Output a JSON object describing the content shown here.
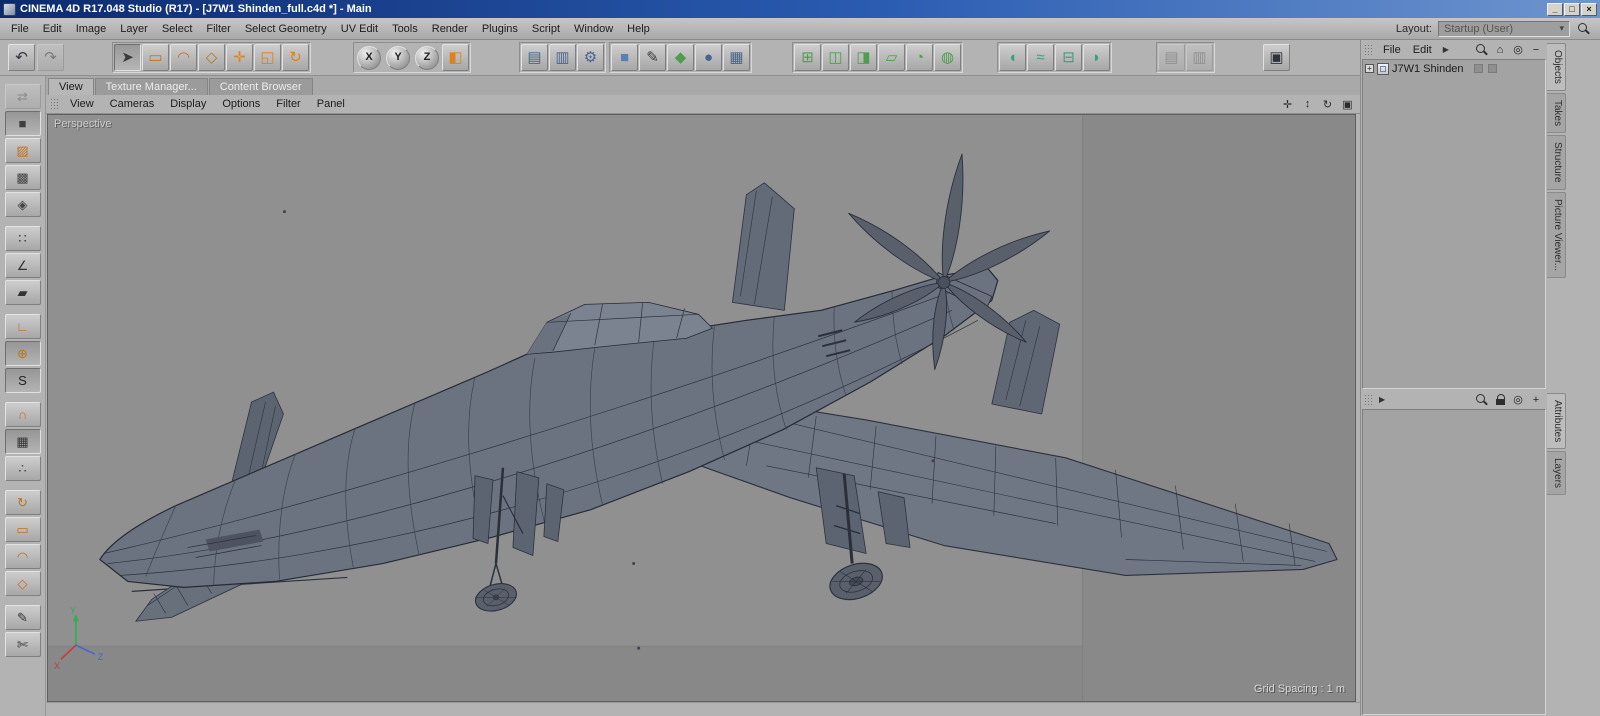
{
  "window": {
    "title": "CINEMA 4D R17.048 Studio (R17) - [J7W1 Shinden_full.c4d *] - Main",
    "controls": [
      {
        "n": "minimize-button",
        "g": "_"
      },
      {
        "n": "maximize-button",
        "g": "□"
      },
      {
        "n": "close-button",
        "g": "×"
      }
    ]
  },
  "menubar": {
    "items": [
      "File",
      "Edit",
      "Image",
      "Layer",
      "Select",
      "Filter",
      "Select Geometry",
      "UV Edit",
      "Tools",
      "Render",
      "Plugins",
      "Script",
      "Window",
      "Help"
    ],
    "layout_label": "Layout:",
    "layout_value": "Startup (User)",
    "layout_caret": "▾"
  },
  "toolbar": {
    "history": [
      {
        "n": "undo-button",
        "g": "↶",
        "c": "#2f343c"
      },
      {
        "n": "redo-button",
        "g": "↷",
        "c": "#2f343c",
        "cls": "disabled"
      }
    ],
    "selection": [
      {
        "n": "live-selection-tool",
        "g": "➤",
        "c": "#3a3a3a",
        "cls": "active"
      },
      {
        "n": "rectangle-selection-tool",
        "g": "▭",
        "c": "#c0731d"
      },
      {
        "n": "lasso-selection-tool",
        "g": "◠",
        "c": "#c0731d"
      },
      {
        "n": "polygon-selection-tool",
        "g": "◇",
        "c": "#c0731d"
      },
      {
        "n": "move-tool",
        "g": "✛",
        "c": "#d9851c"
      },
      {
        "n": "scale-tool",
        "g": "◱",
        "c": "#d9851c"
      },
      {
        "n": "rotate-tool",
        "g": "↻",
        "c": "#d9851c"
      }
    ],
    "axis": [
      {
        "n": "x-axis-lock-button",
        "g": "X",
        "c": "#222222",
        "cls": "ball"
      },
      {
        "n": "y-axis-lock-button",
        "g": "Y",
        "c": "#222222",
        "cls": "ball"
      },
      {
        "n": "z-axis-lock-button",
        "g": "Z",
        "c": "#222222",
        "cls": "ball"
      },
      {
        "n": "coordinate-system-button",
        "g": "◧",
        "c": "#d9851c"
      }
    ],
    "render": [
      {
        "n": "render-view-button",
        "g": "▤",
        "c": "#49648f"
      },
      {
        "n": "render-picture-viewer-button",
        "g": "▥",
        "c": "#49648f"
      },
      {
        "n": "render-settings-button",
        "g": "⚙",
        "c": "#49648f"
      }
    ],
    "create": [
      {
        "n": "add-cube-button",
        "g": "■",
        "c": "#5b7fb5"
      },
      {
        "n": "spline-pen-button",
        "g": "✎",
        "c": "#3c3c3c"
      },
      {
        "n": "subdivision-surface-button",
        "g": "◆",
        "c": "#4e9e4e"
      },
      {
        "n": "volume-builder-button",
        "g": "●",
        "c": "#49648f"
      },
      {
        "n": "floor-button",
        "g": "▦",
        "c": "#49648f"
      }
    ],
    "modeling": [
      {
        "n": "array-button",
        "g": "⊞",
        "c": "#4e9e4e"
      },
      {
        "n": "boole-button",
        "g": "◫",
        "c": "#4e9e4e"
      },
      {
        "n": "symmetry-button",
        "g": "◨",
        "c": "#4e9e4e"
      },
      {
        "n": "instance-button",
        "g": "▱",
        "c": "#4e9e4e"
      },
      {
        "n": "spline-mask-button",
        "g": "◔",
        "c": "#4e9e4e"
      },
      {
        "n": "connect-button",
        "g": "◍",
        "c": "#4e9e4e"
      }
    ],
    "deformers": [
      {
        "n": "bend-deformer-button",
        "g": "◖",
        "c": "#3f9e7a"
      },
      {
        "n": "twist-deformer-button",
        "g": "≈",
        "c": "#3f9e7a"
      },
      {
        "n": "ffd-deformer-button",
        "g": "⊟",
        "c": "#3f9e7a"
      },
      {
        "n": "taper-deformer-button",
        "g": "◗",
        "c": "#3f9e7a"
      }
    ],
    "extras": [
      {
        "n": "workplane-toggle-button",
        "g": "▤",
        "c": "#666666",
        "cls": "disabled"
      },
      {
        "n": "snap-settings-button",
        "g": "▥",
        "c": "#666666",
        "cls": "disabled"
      }
    ],
    "panel": [
      {
        "n": "viewport-panel-button",
        "g": "▣",
        "c": "#2f343c"
      }
    ]
  },
  "left_toolbar": {
    "items": [
      {
        "n": "make-editable-button",
        "g": "⇄",
        "c": "#555555",
        "cls": "disabled"
      },
      {
        "n": "model-mode-button",
        "g": "■",
        "c": "#3e3e3e",
        "cls": "active"
      },
      {
        "n": "texture-mode-button",
        "g": "▨",
        "c": "#c0731d"
      },
      {
        "n": "texture-button",
        "g": "▩",
        "c": "#444444"
      },
      {
        "n": "workplane-button",
        "g": "◈",
        "c": "#444444"
      },
      {
        "n": "separator",
        "cls": "spacer"
      },
      {
        "n": "points-mode-button",
        "g": "∷",
        "c": "#333333"
      },
      {
        "n": "edges-mode-button",
        "g": "∠",
        "c": "#333333"
      },
      {
        "n": "polygons-mode-button",
        "g": "▰",
        "c": "#333333"
      },
      {
        "n": "separator",
        "cls": "spacer"
      },
      {
        "n": "object-axis-button",
        "g": "∟",
        "c": "#c0731d"
      },
      {
        "n": "enable-axis-button",
        "g": "⊕",
        "c": "#c0731d",
        "cls": "active"
      },
      {
        "n": "snap-button",
        "g": "S",
        "c": "#222222",
        "cls": "active"
      },
      {
        "n": "separator",
        "cls": "spacer"
      },
      {
        "n": "magnet-button",
        "g": "∩",
        "c": "#c0731d"
      },
      {
        "n": "grid-snap-button",
        "g": "▦",
        "c": "#333333",
        "cls": "active"
      },
      {
        "n": "quantize-button",
        "g": "∴",
        "c": "#444444"
      },
      {
        "n": "separator",
        "cls": "spacer"
      },
      {
        "n": "rotate-ring-button",
        "g": "↻",
        "c": "#c0731d"
      },
      {
        "n": "rect-select-button",
        "g": "▭",
        "c": "#c0731d"
      },
      {
        "n": "lasso-select-button",
        "g": "◠",
        "c": "#c0731d"
      },
      {
        "n": "poly-select-button",
        "g": "◇",
        "c": "#c0731d"
      },
      {
        "n": "separator",
        "cls": "spacer"
      },
      {
        "n": "brush-button",
        "g": "✎",
        "c": "#333333"
      },
      {
        "n": "knife-button",
        "g": "✄",
        "c": "#333333"
      }
    ]
  },
  "center": {
    "doc_tabs": [
      {
        "n": "tab-view",
        "label": "View",
        "cls": "active"
      },
      {
        "n": "tab-texture-manager",
        "label": "Texture Manager..."
      },
      {
        "n": "tab-content-browser",
        "label": "Content Browser"
      }
    ],
    "vp_menus": [
      "View",
      "Cameras",
      "Display",
      "Options",
      "Filter",
      "Panel"
    ],
    "nav_icons": [
      {
        "n": "pan-view-icon",
        "g": "✛"
      },
      {
        "n": "zoom-view-icon",
        "g": "↕"
      },
      {
        "n": "rotate-view-icon",
        "g": "↻"
      },
      {
        "n": "maximize-view-icon",
        "g": "▣"
      }
    ],
    "viewport": {
      "camera_label": "Perspective",
      "grid_spacing": "Grid Spacing : 1 m",
      "axis": {
        "x": "X",
        "y": "Y",
        "z": "Z"
      }
    }
  },
  "object_manager": {
    "menus": [
      "File",
      "Edit"
    ],
    "more_glyph": "▶",
    "icons": [
      {
        "n": "search-icon",
        "icon": "ic-mag"
      },
      {
        "n": "home-icon",
        "g": "⌂"
      },
      {
        "n": "focus-icon",
        "g": "◎"
      },
      {
        "n": "minimize-icon",
        "g": "−"
      }
    ],
    "tree": [
      {
        "label": "J7W1 Shinden",
        "expand": "+"
      }
    ]
  },
  "attribute_manager": {
    "more_glyph": "▶",
    "icons": [
      {
        "n": "search-icon",
        "icon": "ic-mag"
      },
      {
        "n": "lock-icon",
        "icon": "ic-lock"
      },
      {
        "n": "focus-icon",
        "g": "◎"
      },
      {
        "n": "new-panel-icon",
        "g": "+"
      }
    ]
  },
  "right_tabs_top": [
    {
      "n": "tab-objects",
      "label": "Objects",
      "cls": "active"
    },
    {
      "n": "tab-takes",
      "label": "Takes"
    },
    {
      "n": "tab-structure",
      "label": "Structure"
    },
    {
      "n": "tab-picture-viewer",
      "label": "Picture Viewer..."
    }
  ],
  "right_tabs_bottom": [
    {
      "n": "tab-attributes",
      "label": "Attributes",
      "cls": "active"
    },
    {
      "n": "tab-layers",
      "label": "Layers"
    }
  ]
}
